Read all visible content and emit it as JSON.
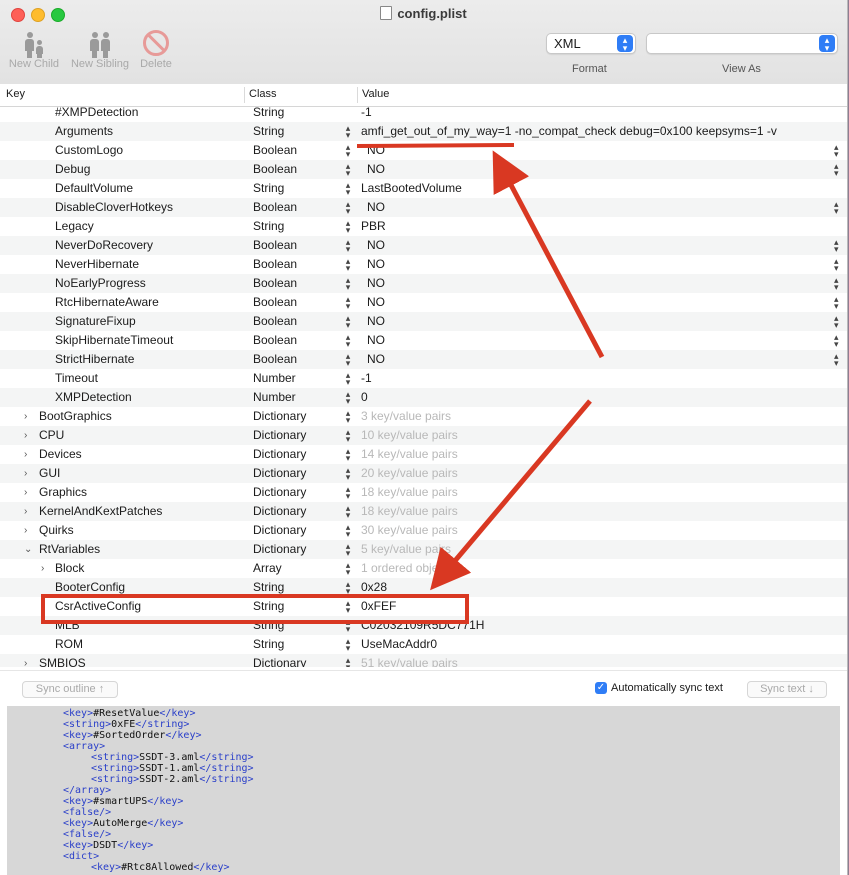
{
  "window": {
    "title": "config.plist",
    "toolbar": {
      "new_child": "New Child",
      "new_sibling": "New Sibling",
      "delete": "Delete",
      "format_value": "XML",
      "format_label": "Format",
      "viewas_value": "",
      "viewas_label": "View As"
    }
  },
  "columns": {
    "key": "Key",
    "class": "Class",
    "value": "Value"
  },
  "rows": [
    {
      "key": "#XMPDetection",
      "cls": "String",
      "val": "-1"
    },
    {
      "key": "Arguments",
      "cls": "String",
      "val": "amfi_get_out_of_my_way=1 -no_compat_check debug=0x100 keepsyms=1 -v"
    },
    {
      "key": "CustomLogo",
      "cls": "Boolean",
      "val": "NO"
    },
    {
      "key": "Debug",
      "cls": "Boolean",
      "val": "NO"
    },
    {
      "key": "DefaultVolume",
      "cls": "String",
      "val": "LastBootedVolume"
    },
    {
      "key": "DisableCloverHotkeys",
      "cls": "Boolean",
      "val": "NO"
    },
    {
      "key": "Legacy",
      "cls": "String",
      "val": "PBR"
    },
    {
      "key": "NeverDoRecovery",
      "cls": "Boolean",
      "val": "NO"
    },
    {
      "key": "NeverHibernate",
      "cls": "Boolean",
      "val": "NO"
    },
    {
      "key": "NoEarlyProgress",
      "cls": "Boolean",
      "val": "NO"
    },
    {
      "key": "RtcHibernateAware",
      "cls": "Boolean",
      "val": "NO"
    },
    {
      "key": "SignatureFixup",
      "cls": "Boolean",
      "val": "NO"
    },
    {
      "key": "SkipHibernateTimeout",
      "cls": "Boolean",
      "val": "NO"
    },
    {
      "key": "StrictHibernate",
      "cls": "Boolean",
      "val": "NO"
    },
    {
      "key": "Timeout",
      "cls": "Number",
      "val": "-1"
    },
    {
      "key": "XMPDetection",
      "cls": "Number",
      "val": "0"
    },
    {
      "key": "BootGraphics",
      "cls": "Dictionary",
      "val": "3 key/value pairs"
    },
    {
      "key": "CPU",
      "cls": "Dictionary",
      "val": "10 key/value pairs"
    },
    {
      "key": "Devices",
      "cls": "Dictionary",
      "val": "14 key/value pairs"
    },
    {
      "key": "GUI",
      "cls": "Dictionary",
      "val": "20 key/value pairs"
    },
    {
      "key": "Graphics",
      "cls": "Dictionary",
      "val": "18 key/value pairs"
    },
    {
      "key": "KernelAndKextPatches",
      "cls": "Dictionary",
      "val": "18 key/value pairs"
    },
    {
      "key": "Quirks",
      "cls": "Dictionary",
      "val": "30 key/value pairs"
    },
    {
      "key": "RtVariables",
      "cls": "Dictionary",
      "val": "5 key/value pairs"
    },
    {
      "key": "Block",
      "cls": "Array",
      "val": "1 ordered object"
    },
    {
      "key": "BooterConfig",
      "cls": "String",
      "val": "0x28"
    },
    {
      "key": "CsrActiveConfig",
      "cls": "String",
      "val": "0xFEF"
    },
    {
      "key": "MLB",
      "cls": "String",
      "val": "C02032109R5DC771H"
    },
    {
      "key": "ROM",
      "cls": "String",
      "val": "UseMacAddr0"
    },
    {
      "key": "SMBIOS",
      "cls": "Dictionary",
      "val": "51 key/value pairs"
    }
  ],
  "sync": {
    "sync_outline": "Sync outline ↑",
    "auto_sync": "Automatically sync text",
    "sync_text": "Sync text ↓"
  },
  "xml_lines": [
    {
      "open": "<key>",
      "text": "#ResetValue",
      "close": "</key>"
    },
    {
      "open": "<string>",
      "text": "0xFE",
      "close": "</string>"
    },
    {
      "open": "<key>",
      "text": "#SortedOrder",
      "close": "</key>"
    },
    {
      "open": "<array>",
      "text": "",
      "close": ""
    },
    {
      "open": "<string>",
      "text": "SSDT-3.aml",
      "close": "</string>"
    },
    {
      "open": "<string>",
      "text": "SSDT-1.aml",
      "close": "</string>"
    },
    {
      "open": "<string>",
      "text": "SSDT-2.aml",
      "close": "</string>"
    },
    {
      "open": "</array>",
      "text": "",
      "close": ""
    },
    {
      "open": "<key>",
      "text": "#smartUPS",
      "close": "</key>"
    },
    {
      "open": "<false/>",
      "text": "",
      "close": ""
    },
    {
      "open": "<key>",
      "text": "AutoMerge",
      "close": "</key>"
    },
    {
      "open": "<false/>",
      "text": "",
      "close": ""
    },
    {
      "open": "<key>",
      "text": "DSDT",
      "close": "</key>"
    },
    {
      "open": "<dict>",
      "text": "",
      "close": ""
    },
    {
      "open": "<key>",
      "text": "#Rtc8Allowed",
      "close": "</key>"
    }
  ],
  "colors": {
    "accent": "#2f7df6",
    "annotation": "#d93822"
  }
}
